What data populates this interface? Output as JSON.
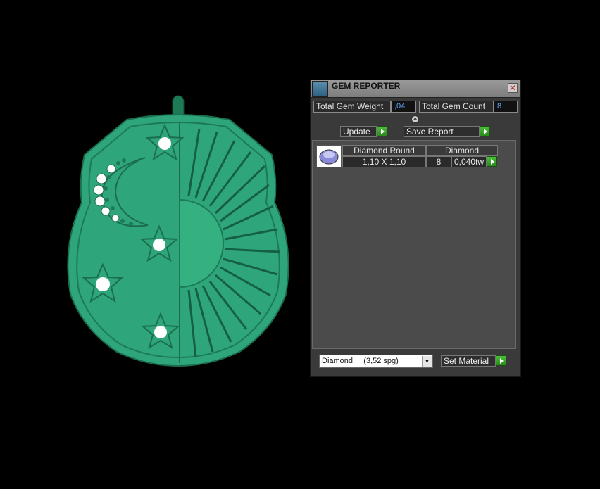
{
  "panel": {
    "title": "GEM REPORTER",
    "close_glyph": "✕",
    "stats": {
      "total_gem_weight_label": "Total Gem Weight",
      "total_gem_weight_value": ",04",
      "total_gem_count_label": "Total Gem Count",
      "total_gem_count_value": "8"
    },
    "collapse_glyph": "⏶",
    "buttons": {
      "update_label": "Update",
      "save_report_label": "Save Report",
      "set_material_label": "Set Material"
    },
    "gem_table": {
      "headers": [
        "Diamond Round",
        "Diamond"
      ],
      "row": {
        "size": "1,10 X 1,10",
        "count": "8",
        "weight": "0,040tw"
      }
    },
    "material_select": {
      "selected": "Diamond     (3,52 spg)",
      "arrow_glyph": "▼"
    }
  },
  "viewport": {
    "object": "shield-pendant",
    "colors": {
      "background": "#000000",
      "metal": "#2ea57a",
      "metal_dark": "#1d7a56",
      "gem": "#ffffff"
    }
  },
  "icons": {
    "title_icon": "gem-reporter-icon",
    "gem_icon": "round-diamond-icon"
  }
}
